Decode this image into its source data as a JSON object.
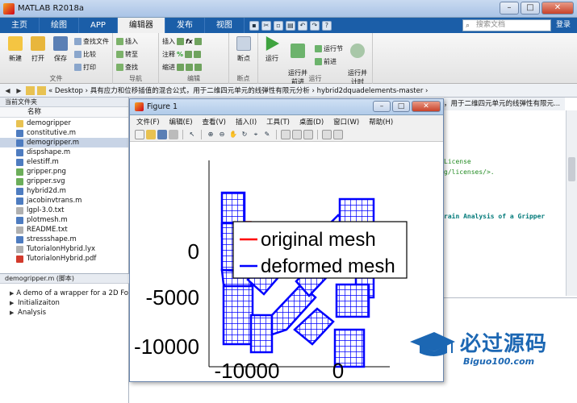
{
  "window": {
    "title": "MATLAB R2018a",
    "minimize": "–",
    "maximize": "□",
    "close": "✕"
  },
  "tabs": [
    "主页",
    "绘图",
    "APP",
    "编辑器",
    "发布",
    "视图"
  ],
  "active_tab": "编辑器",
  "search": {
    "placeholder": "搜索文档",
    "help": "登录"
  },
  "ribbon": {
    "file_group": {
      "caption": "文件",
      "new": "新建",
      "open": "打开",
      "save": "保存",
      "find_files": "查找文件",
      "compare": "比较",
      "print": "打印"
    },
    "nav_group": {
      "caption": "导航",
      "insert": "插入",
      "goto": "转至",
      "find": "查找"
    },
    "edit_group": {
      "caption": "编辑",
      "insert": "插入",
      "comment": "注释",
      "indent": "缩进"
    },
    "breakpoints_group": {
      "caption": "断点",
      "breakpoints": "断点"
    },
    "run_group": {
      "caption": "运行",
      "run": "运行",
      "run_advance": "运行并\n前进",
      "run_section": "运行节",
      "advance": "前进",
      "run_time": "运行并\n计时"
    }
  },
  "address_bar": {
    "path": "« Desktop › 具有应力和位移插值的混合公式，用于二维四元单元的线弹性有限元分析 › hybrid2dquadelements-master ›"
  },
  "current_folder": {
    "header": "当前文件夹",
    "column": "名称",
    "files": [
      {
        "name": "demogripper",
        "type": "folder"
      },
      {
        "name": "constitutive.m",
        "type": "m"
      },
      {
        "name": "demogripper.m",
        "type": "m",
        "selected": true
      },
      {
        "name": "dispshape.m",
        "type": "m"
      },
      {
        "name": "elestiff.m",
        "type": "m"
      },
      {
        "name": "gripper.png",
        "type": "img"
      },
      {
        "name": "gripper.svg",
        "type": "img"
      },
      {
        "name": "hybrid2d.m",
        "type": "m"
      },
      {
        "name": "jacobinvtrans.m",
        "type": "m"
      },
      {
        "name": "lgpl-3.0.txt",
        "type": "txt"
      },
      {
        "name": "plotmesh.m",
        "type": "m"
      },
      {
        "name": "README.txt",
        "type": "txt"
      },
      {
        "name": "stressshape.m",
        "type": "m"
      },
      {
        "name": "TutorialonHybrid.lyx",
        "type": "txt"
      },
      {
        "name": "TutorialonHybrid.pdf",
        "type": "pdf"
      }
    ]
  },
  "details": {
    "header": "demogripper.m (脚本)",
    "items": [
      "A demo of a wrapper for a 2D Fo",
      "Initializaiton",
      "Analysis"
    ]
  },
  "editor": {
    "tab_text": "，用于二维四元单元的线弹性有限元...",
    "lines": [
      {
        "text": "License",
        "style": "green"
      },
      {
        "text": "g/licenses/>.",
        "style": "green"
      },
      {
        "text": "rain Analysis of a Gripper",
        "style": "teal"
      }
    ]
  },
  "figure": {
    "title": "Figure 1",
    "menu": [
      "文件(F)",
      "编辑(E)",
      "查看(V)",
      "插入(I)",
      "工具(T)",
      "桌面(D)",
      "窗口(W)",
      "帮助(H)"
    ]
  },
  "chart_data": {
    "type": "line",
    "title": "",
    "xlabel": "",
    "ylabel": "",
    "xticks": [
      "-10000",
      "0"
    ],
    "yticks": [
      "0",
      "-5000",
      "-10000"
    ],
    "ylim_reversed": true,
    "legend": {
      "placement": "top-right"
    },
    "series": [
      {
        "name": "original mesh",
        "color": "#ff0000"
      },
      {
        "name": "deformed mesh",
        "color": "#0000ff"
      }
    ]
  },
  "watermark": {
    "title": "必过源码",
    "url": "Biguo100.com"
  }
}
